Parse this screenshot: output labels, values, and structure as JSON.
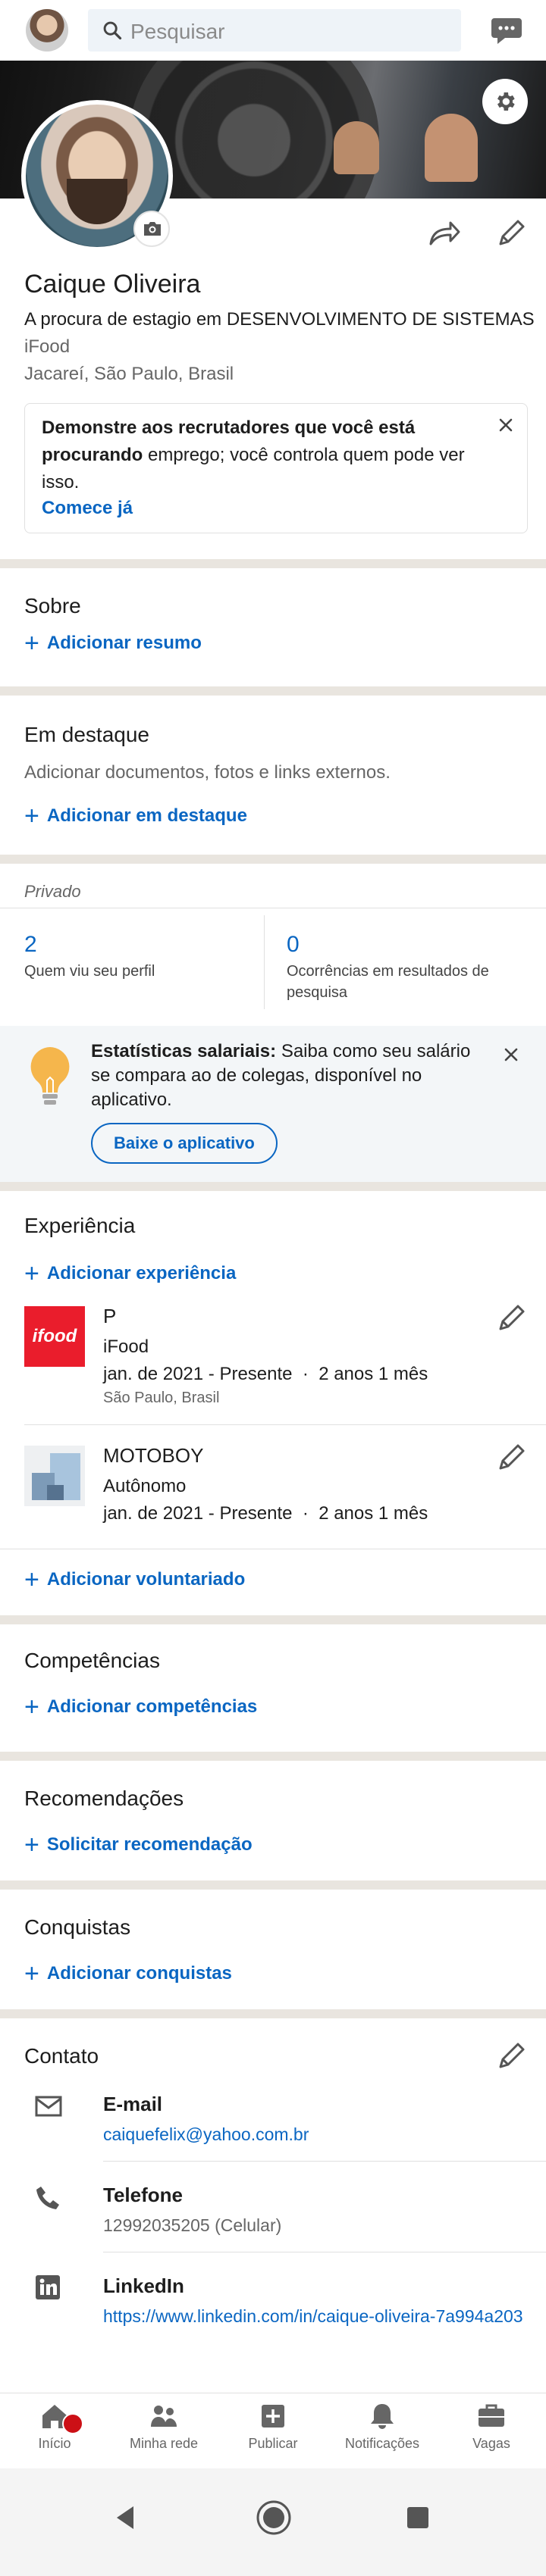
{
  "search": {
    "placeholder": "Pesquisar"
  },
  "profile": {
    "name": "Caique Oliveira",
    "headline": "A procura de estagio em DESENVOLVIMENTO DE SISTEMAS",
    "company": "iFood",
    "location": "Jacareí, São Paulo, Brasil"
  },
  "recruiter_card": {
    "text_bold": "Demonstre aos recrutadores que você está procurando",
    "text_rest": " emprego; você controla quem pode ver isso.",
    "link": "Comece já"
  },
  "about": {
    "title": "Sobre",
    "add": "Adicionar resumo"
  },
  "featured": {
    "title": "Em destaque",
    "description": "Adicionar documentos, fotos e links externos.",
    "add": "Adicionar em destaque"
  },
  "private_label": "Privado",
  "stats": [
    {
      "value": "2",
      "label": "Quem viu seu perfil"
    },
    {
      "value": "0",
      "label": "Ocorrências em resultados de pesquisa"
    }
  ],
  "salary": {
    "bold": "Estatísticas salariais:",
    "rest": " Saiba como seu salário se compara ao de colegas, disponível no aplicativo.",
    "button": "Baixe o aplicativo"
  },
  "experience": {
    "title": "Experiência",
    "add": "Adicionar experiência",
    "items": [
      {
        "logo_text": "ifood",
        "title": "P",
        "company": "iFood",
        "dates": "jan. de 2021 - Presente",
        "duration": "2 anos 1 mês",
        "location": "São Paulo, Brasil"
      },
      {
        "title": "MOTOBOY",
        "company": "Autônomo",
        "dates": "jan. de 2021 - Presente",
        "duration": "2 anos 1 mês"
      }
    ],
    "add_volunteer": "Adicionar voluntariado"
  },
  "skills": {
    "title": "Competências",
    "add": "Adicionar competências"
  },
  "recommendations": {
    "title": "Recomendações",
    "add": "Solicitar recomendação"
  },
  "accomplishments": {
    "title": "Conquistas",
    "add": "Adicionar conquistas"
  },
  "contact": {
    "title": "Contato",
    "items": [
      {
        "label": "E-mail",
        "value": "caiquefelix@yahoo.com.br"
      },
      {
        "label": "Telefone",
        "value": "12992035205 (Celular)"
      },
      {
        "label": "LinkedIn",
        "value": "https://www.linkedin.com/in/caique-oliveira-7a994a203"
      }
    ]
  },
  "nav": [
    {
      "label": "Início"
    },
    {
      "label": "Minha rede"
    },
    {
      "label": "Publicar"
    },
    {
      "label": "Notificações"
    },
    {
      "label": "Vagas"
    }
  ],
  "colors": {
    "accent": "#0a66c2",
    "ifood": "#ea1d2c",
    "badge": "#cc1016",
    "divider": "#e9e5df"
  }
}
